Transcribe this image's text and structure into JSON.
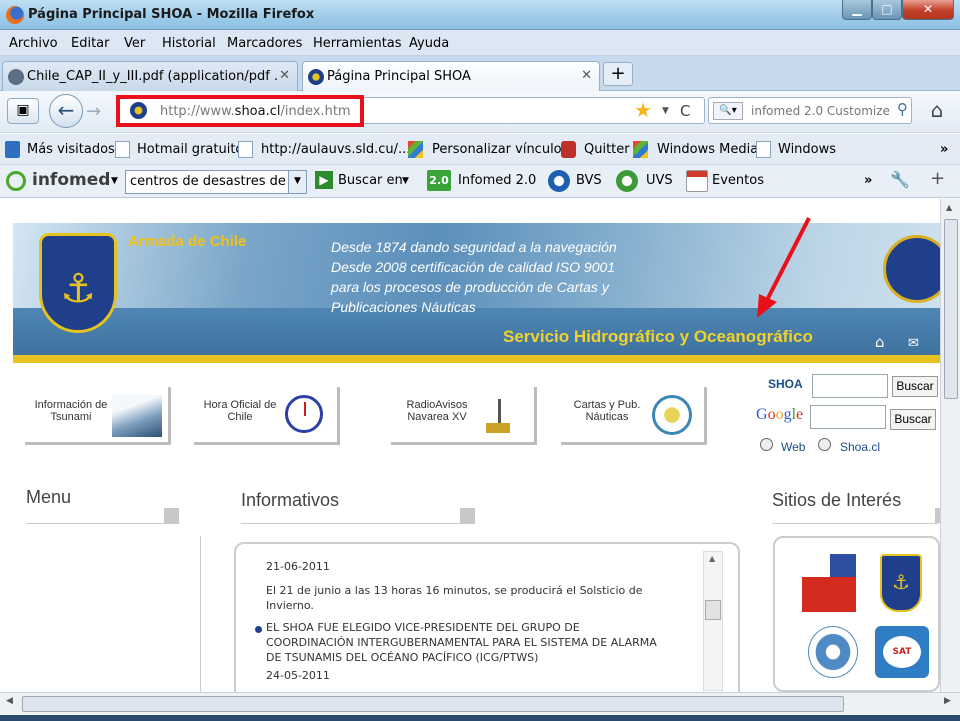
{
  "window": {
    "title": "Página Principal SHOA - Mozilla Firefox",
    "minimize": "▁",
    "maximize": "□",
    "close": "✕"
  },
  "menu": [
    "Archivo",
    "Editar",
    "Ver",
    "Historial",
    "Marcadores",
    "Herramientas",
    "Ayuda"
  ],
  "tabs": [
    {
      "label": "Chile_CAP_II_y_III.pdf (application/pdf ...",
      "close": "✕"
    },
    {
      "label": "Página Principal SHOA",
      "close": "✕"
    }
  ],
  "new_tab": "+",
  "nav": {
    "back": "←",
    "forward": "→",
    "url_prefix": "http://www.",
    "url_host": "shoa.cl",
    "url_path": "/index.htm",
    "reload": "C",
    "search_placeholder": "infomed 2.0 Customize",
    "home": "⌂"
  },
  "bookmarks": [
    "Más visitados",
    "Hotmail gratuito",
    "http://aulauvs.sld.cu/...",
    "Personalizar vínculos",
    "Quitter",
    "Windows Media",
    "Windows"
  ],
  "bookmarks_more": "»",
  "infomed_bar": {
    "brand": "infomed",
    "combo": "centros de desastres de c",
    "buscar": "Buscar en",
    "badge": "2.0",
    "infomed2": "Infomed 2.0",
    "bvs": "BVS",
    "uvs": "UVS",
    "eventos": "Eventos",
    "more": "»"
  },
  "banner": {
    "brand": "Armada de Chile",
    "tagline": [
      "Desde 1874 dando seguridad a la navegación",
      "Desde 2008 certificación de calidad ISO 9001",
      "para los procesos de producción de Cartas y",
      "Publicaciones Náuticas"
    ],
    "service": "Servicio Hidrográfico y Oceanográfico"
  },
  "quick_links": [
    {
      "label": "Información de Tsunami"
    },
    {
      "label": "Hora Oficial de Chile"
    },
    {
      "label": "RadioAvisos Navarea XV"
    },
    {
      "label": "Cartas y Pub. Náuticas"
    }
  ],
  "search": {
    "shoa_label": "SHOA",
    "google_label": "Google",
    "button": "Buscar",
    "radio_web": "Web",
    "radio_shoa": "Shoa.cl"
  },
  "sections": {
    "menu": "Menu",
    "informativos": "Informativos",
    "sitios": "Sitios de Interés"
  },
  "news": {
    "date1": "21-06-2011",
    "text1": "El 21 de junio a las 13 horas 16 minutos, se producirá el Solsticio de Invierno.",
    "headline2": "EL SHOA FUE ELEGIDO VICE-PRESIDENTE DEL GRUPO DE COORDINACIÓN INTERGUBERNAMENTAL PARA EL SISTEMA DE ALARMA DE TSUNAMIS DEL OCÉANO PACÍFICO (ICG/PTWS)",
    "date2": "24-05-2011"
  },
  "sites_logos": {
    "gob": "Gobierno de Chile",
    "sat": "SAT"
  },
  "colors": {
    "highlight_red": "#e8101a",
    "banner_yellow": "#e6c21e",
    "link_blue": "#1d4c8c"
  }
}
